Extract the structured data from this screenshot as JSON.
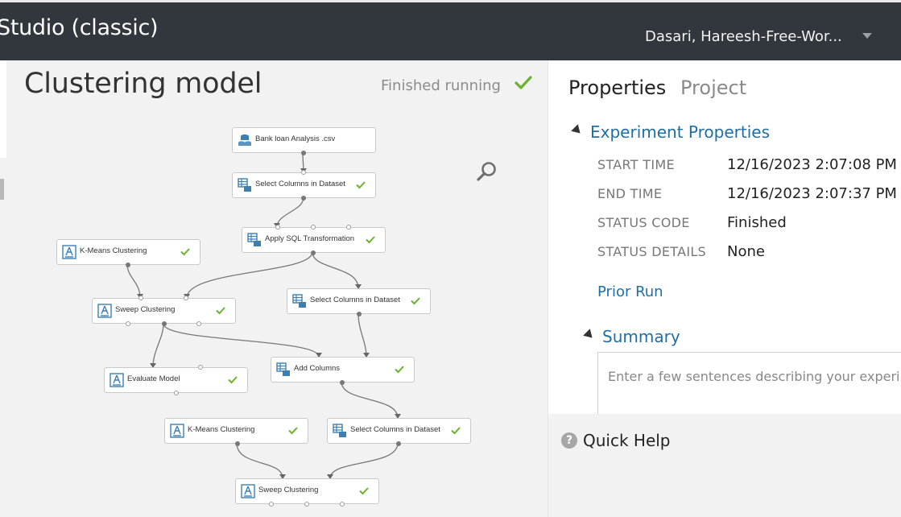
{
  "app": {
    "title": "Studio (classic)",
    "user": "Dasari, Hareesh-Free-Wor..."
  },
  "experiment": {
    "title": "Clustering model",
    "status": "Finished running"
  },
  "modules": [
    {
      "label": "Bank loan Analysis .csv",
      "kind": "dataset",
      "completed": false
    },
    {
      "label": "Select Columns in Dataset",
      "kind": "table",
      "completed": true
    },
    {
      "label": "Apply SQL Transformation",
      "kind": "table",
      "completed": true
    },
    {
      "label": "K-Means Clustering",
      "kind": "model",
      "completed": true
    },
    {
      "label": "Sweep Clustering",
      "kind": "model",
      "completed": true
    },
    {
      "label": "Select Columns in Dataset",
      "kind": "table",
      "completed": true
    },
    {
      "label": "Evaluate Model",
      "kind": "model",
      "completed": true
    },
    {
      "label": "Add Columns",
      "kind": "table",
      "completed": true
    },
    {
      "label": "K-Means Clustering",
      "kind": "model",
      "completed": true
    },
    {
      "label": "Select Columns in Dataset",
      "kind": "table",
      "completed": true
    },
    {
      "label": "Sweep Clustering",
      "kind": "model",
      "completed": true
    }
  ],
  "properties": {
    "tabs": {
      "properties": "Properties",
      "project": "Project"
    },
    "section_title": "Experiment Properties",
    "rows": [
      {
        "key": "START TIME",
        "value": "12/16/2023 2:07:08 PM"
      },
      {
        "key": "END TIME",
        "value": "12/16/2023 2:07:37 PM"
      },
      {
        "key": "STATUS CODE",
        "value": "Finished"
      },
      {
        "key": "STATUS DETAILS",
        "value": "None"
      }
    ],
    "prior_run": "Prior Run",
    "summary_title": "Summary",
    "summary_placeholder": "Enter a few sentences describing your experim"
  },
  "quick_help": {
    "title": "Quick Help",
    "icon": "?"
  },
  "colors": {
    "topbar": "#32373d",
    "accent": "#1f6fa6",
    "check": "#6bb32e",
    "canvas": "#f2f2f2"
  }
}
